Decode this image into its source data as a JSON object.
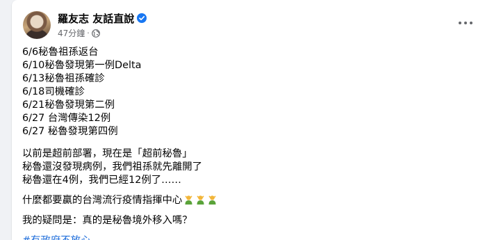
{
  "post": {
    "author": "羅友志 友話直說",
    "time": "47分鐘",
    "separator": "·",
    "verified_icon": "verified-badge-icon",
    "privacy_icon": "globe-icon",
    "timeline": [
      "6/6秘魯祖孫返台",
      "6/10秘魯發現第一例Delta",
      "6/13秘魯祖孫確診",
      "6/18司機確診",
      "6/21秘魯發現第二例",
      "6/27 台灣傳染12例",
      "6/27 秘魯發現第四例"
    ],
    "paragraph2": [
      "以前是超前部署，現在是「超前秘魯」",
      "秘魯還沒發現病例，我們祖孫就先離開了",
      "秘魯還在4例，我們已經12例了……"
    ],
    "paragraph3": "什麼都要贏的台灣流行疫情指揮中心",
    "paragraph3_emoji": "person-gesturing-ok-emoji",
    "question": "我的疑問是：真的是秘魯境外移入嗎？",
    "hashtag": "#有政府不放心"
  },
  "colors": {
    "link": "#216fdb",
    "secondary_text": "#65676b",
    "verified": "#1877f2",
    "emoji_skin": "#f2b63a",
    "emoji_shirt": "#5aa33a"
  }
}
